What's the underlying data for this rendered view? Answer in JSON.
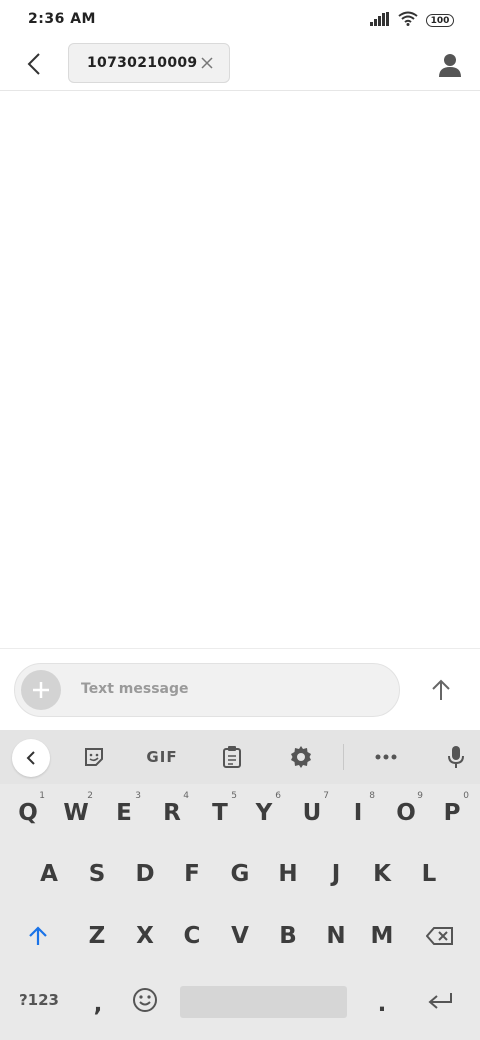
{
  "status_bar": {
    "time": "2:36 AM",
    "battery": "100"
  },
  "header": {
    "recipient_chip": "10730210009"
  },
  "composer": {
    "placeholder": "Text message"
  },
  "keyboard": {
    "toolbar": {
      "gif": "GIF"
    },
    "rows": [
      [
        {
          "key": "Q",
          "hint": "1"
        },
        {
          "key": "W",
          "hint": "2"
        },
        {
          "key": "E",
          "hint": "3"
        },
        {
          "key": "R",
          "hint": "4"
        },
        {
          "key": "T",
          "hint": "5"
        },
        {
          "key": "Y",
          "hint": "6"
        },
        {
          "key": "U",
          "hint": "7"
        },
        {
          "key": "I",
          "hint": "8"
        },
        {
          "key": "O",
          "hint": "9"
        },
        {
          "key": "P",
          "hint": "0"
        }
      ],
      [
        {
          "key": "A"
        },
        {
          "key": "S"
        },
        {
          "key": "D"
        },
        {
          "key": "F"
        },
        {
          "key": "G"
        },
        {
          "key": "H"
        },
        {
          "key": "J"
        },
        {
          "key": "K"
        },
        {
          "key": "L"
        }
      ],
      [
        {
          "key": "Z"
        },
        {
          "key": "X"
        },
        {
          "key": "C"
        },
        {
          "key": "V"
        },
        {
          "key": "B"
        },
        {
          "key": "N"
        },
        {
          "key": "M"
        }
      ]
    ],
    "bottom_row": {
      "symbols": "?123",
      "comma": ",",
      "period": "."
    }
  },
  "colors": {
    "accent": "#1a73e8",
    "keyboard_bg": "#e9e9e9",
    "chip_bg": "#f1f1f1"
  }
}
